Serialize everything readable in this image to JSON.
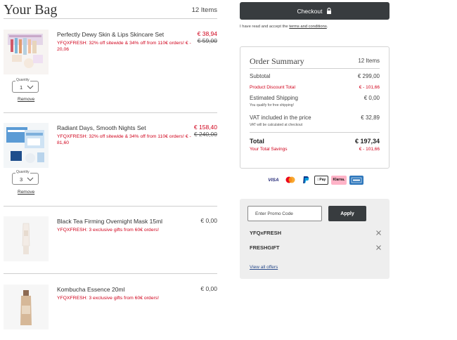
{
  "bag": {
    "title": "Your Bag",
    "count": "12 Items"
  },
  "items": [
    {
      "name": "Perfectly Dewy Skin & Lips Skincare Set",
      "price": "€ 38,94",
      "was_price": "€ 59,00",
      "promo": "YFQXFRESH: 32% off sitewide & 34% off from 110€ orders! € - 20,06",
      "quantity_label": "Quantity",
      "quantity": "1",
      "remove_label": "Remove"
    },
    {
      "name": "Radiant Days, Smooth Nights Set",
      "price": "€ 158,40",
      "was_price": "€ 240,00",
      "promo": "YFQXFRESH: 32% off sitewide & 34% off from 110€ orders! € - 81,60",
      "quantity_label": "Quantity",
      "quantity": "3",
      "remove_label": "Remove"
    },
    {
      "name": "Black Tea Firming Overnight Mask 15ml",
      "price": "€ 0,00",
      "promo": "YFQXFRESH: 3 exclusive gifts from 60€ orders!"
    },
    {
      "name": "Kombucha Essence 20ml",
      "price": "€ 0,00",
      "promo": "YFQXFRESH: 3 exclusive gifts from 60€ orders!"
    }
  ],
  "checkout": {
    "label": "Checkout",
    "terms_prefix": "I have read and accept the ",
    "terms_link": "terms and conditions",
    "terms_suffix": "."
  },
  "summary": {
    "title": "Order Summary",
    "count": "12 Items",
    "subtotal_label": "Subtotal",
    "subtotal": "€ 299,00",
    "discount_label": "Product Discount Total",
    "discount": "€ - 101,66",
    "shipping_label": "Estimated Shipping",
    "shipping": "€ 0,00",
    "shipping_note": "You qualify for free shipping!",
    "vat_label": "VAT included in the price",
    "vat": "€ 32,89",
    "vat_note": "VAT will be calculated at checkout",
    "total_label": "Total",
    "total": "€ 197,34",
    "savings_label": "Your Total Savings",
    "savings": "€ - 101,66"
  },
  "payments": [
    "VISA",
    "Mastercard",
    "PayPal",
    "Apple Pay",
    "Klarna.",
    "American Express"
  ],
  "promo": {
    "placeholder": "Enter Promo Code",
    "apply_label": "Apply",
    "codes": [
      "YFQxFRESH",
      "FRESHGIFT"
    ],
    "view_all": "View all offers"
  },
  "colors": {
    "accent_red": "#d0021b",
    "button_dark": "#383c3f",
    "panel_grey": "#eeeeee"
  }
}
